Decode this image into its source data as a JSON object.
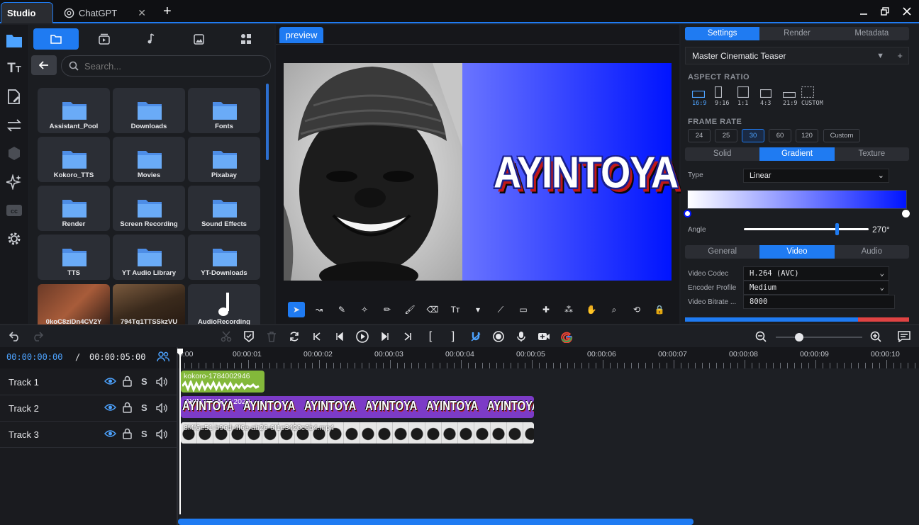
{
  "tabs": [
    {
      "label": "Studio"
    },
    {
      "label": "ChatGPT"
    }
  ],
  "media": {
    "search_placeholder": "Search...",
    "folders": [
      "Assistant_Pool",
      "Downloads",
      "Fonts",
      "Kokoro_TTS",
      "Movies",
      "Pixabay",
      "Render",
      "Screen Recording",
      "Sound Effects",
      "TTS",
      "YT Audio Library",
      "YT-Downloads"
    ],
    "files": [
      "0koC8ziDn4CV2Y",
      "794Tq1TTSSkzVU",
      "AudioRecording"
    ]
  },
  "preview": {
    "tab_label": "preview",
    "overlay_text": "AYINTOYA"
  },
  "settings": {
    "tabs": [
      "Settings",
      "Render",
      "Metadata"
    ],
    "preset": "Master Cinematic Teaser",
    "aspect_title": "ASPECT RATIO",
    "aspects": [
      "16:9",
      "9:16",
      "1:1",
      "4:3",
      "21:9",
      "CUSTOM"
    ],
    "fps_title": "FRAME RATE",
    "fps": [
      "24",
      "25",
      "30",
      "60",
      "120",
      "Custom"
    ],
    "bg_tabs": [
      "Solid",
      "Gradient",
      "Texture"
    ],
    "type_label": "Type",
    "type_value": "Linear",
    "angle_label": "Angle",
    "angle_value": "270°",
    "out_tabs": [
      "General",
      "Video",
      "Audio"
    ],
    "codec_label": "Video Codec",
    "codec_value": "H.264 (AVC)",
    "profile_label": "Encoder Profile",
    "profile_value": "Medium",
    "bitrate_label": "Video Bitrate ...",
    "bitrate_value": "8000",
    "colors": {
      "accent": "#1f7bf2",
      "gradient_start": "#ffffff",
      "gradient_end": "#0014ff"
    }
  },
  "timeline": {
    "current_time": "00:00:00:00",
    "separator": "/",
    "total_time": "00:00:05:00",
    "ticks": [
      "0:00",
      "00:00:01",
      "00:00:02",
      "00:00:03",
      "00:00:04",
      "00:00:05",
      "00:00:06",
      "00:00:07",
      "00:00:08",
      "00:00:09",
      "00:00:10"
    ],
    "tracks": [
      {
        "name": "Track 1"
      },
      {
        "name": "Track 2"
      },
      {
        "name": "Track 3"
      }
    ],
    "solo_label": "S",
    "clips": {
      "audio": "kokoro-1784002946",
      "text": "AYINTOYA 12:2029",
      "text_repeat": "AYINTOYA",
      "video": "8f4f6e51-b96d-4f6e-ab26-6f1e3420c6b4.mp4"
    }
  }
}
